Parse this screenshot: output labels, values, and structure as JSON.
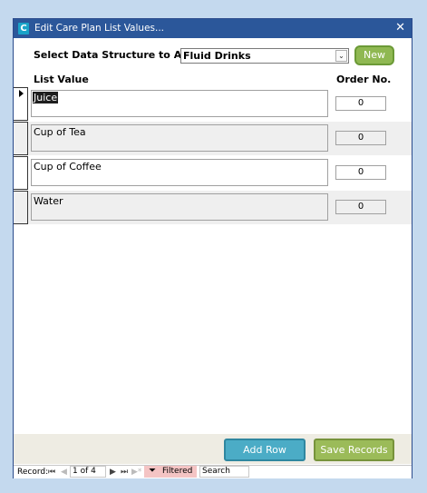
{
  "window": {
    "title": "Edit Care Plan List Values...",
    "close_glyph": "✕",
    "app_icon_letter": "C"
  },
  "filter": {
    "label": "Select Data Structure to Amend:",
    "selected": "Fluid Drinks",
    "dropdown_glyph": "⌄",
    "new_label": "New"
  },
  "columns": {
    "list_value": "List Value",
    "order_no": "Order No."
  },
  "rows": [
    {
      "value": "Juice",
      "order": "0"
    },
    {
      "value": "Cup of Tea",
      "order": "0"
    },
    {
      "value": "Cup of Coffee",
      "order": "0"
    },
    {
      "value": "Water",
      "order": "0"
    }
  ],
  "footer": {
    "add_row_label": "Add Row",
    "save_label": "Save Records"
  },
  "navigation": {
    "record_label": "Record:",
    "first": "⏮",
    "prev": "◀",
    "current": "1 of 4",
    "next": "▶",
    "last": "⏭",
    "new": "▶*",
    "filtered_label": "Filtered",
    "search_label": "Search"
  },
  "colors": {
    "titlebar": "#2b579a",
    "new_button": "#8fb852",
    "add_row_button": "#4bacc6",
    "save_button": "#9bbb59",
    "background": "#c4d9ee"
  }
}
